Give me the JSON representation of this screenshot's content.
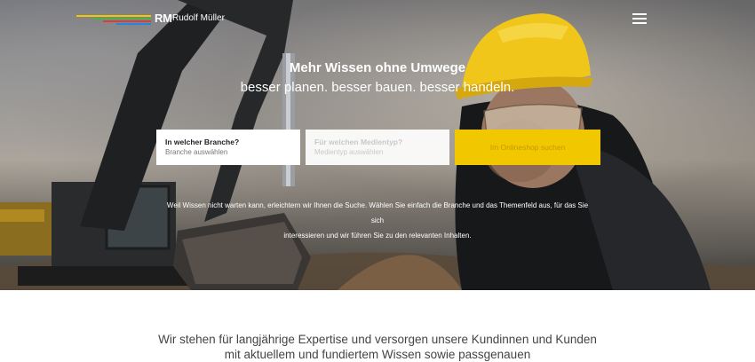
{
  "header": {
    "logo_short": "RM",
    "logo_name": "Rudolf Müller",
    "menu_icon": "hamburger-menu-icon"
  },
  "hero": {
    "headline": "Mehr Wissen ohne Umwege",
    "subheadline": "besser planen. besser bauen. besser handeln.",
    "branche_field": {
      "label": "In welcher Branche?",
      "value": "Branche auswählen"
    },
    "medientyp_field": {
      "label": "Für welchen Medientyp?",
      "value": "Medientyp auswählen"
    },
    "search_button": "Im Onlineshop suchen",
    "intro_line1": "Weil Wissen nicht warten kann, erleichtern wir Ihnen die Suche. Wählen Sie einfach die Branche und das Themenfeld aus, für das Sie sich",
    "intro_line2": "interessieren und wir führen Sie zu den relevanten Inhalten."
  },
  "section": {
    "line1": "Wir stehen für langjährige Expertise und versorgen unsere Kundinnen und Kunden",
    "line2": "mit aktuellem und fundiertem Wissen sowie passgenauen"
  },
  "colors": {
    "accent": "#f1c800",
    "logo_stripes": [
      "#f1c800",
      "#4caf50",
      "#e53935",
      "#1e88e5"
    ]
  }
}
